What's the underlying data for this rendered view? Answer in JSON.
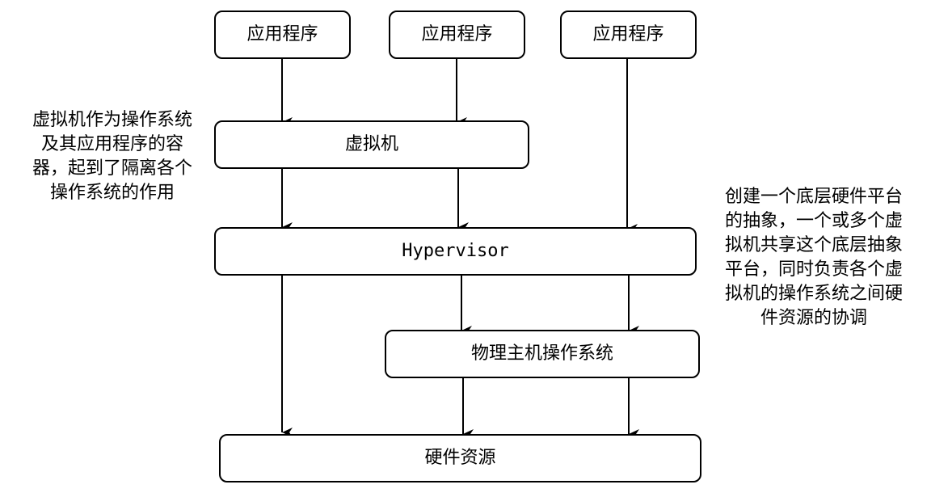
{
  "boxes": {
    "app_1": "应用程序",
    "app_2": "应用程序",
    "app_3": "应用程序",
    "virtual_machine": "虚拟机",
    "hypervisor": "Hypervisor",
    "host_os": "物理主机操作系统",
    "hardware": "硬件资源"
  },
  "notes": {
    "left": [
      "虚拟机作为操作系统",
      "及其应用程序的容",
      "器，起到了隔离各个",
      "操作系统的作用"
    ],
    "right": [
      "创建一个底层硬件平台",
      "的抽象，一个或多个虚",
      "拟机共享这个底层抽象",
      "平台，同时负责各个虚",
      "拟机的操作系统之间硬",
      "件资源的协调"
    ]
  },
  "colors": {
    "stroke": "#000000",
    "background": "#ffffff"
  }
}
